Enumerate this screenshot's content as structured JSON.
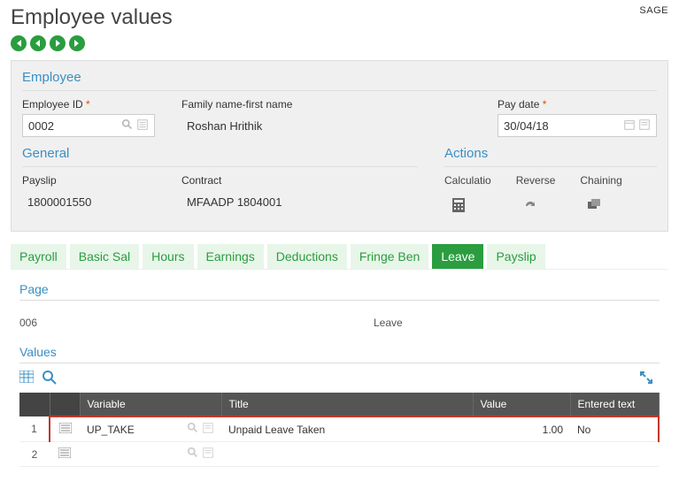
{
  "brand": "SAGE",
  "page_title": "Employee values",
  "employee_section": {
    "title": "Employee",
    "id_label": "Employee ID",
    "id_value": "0002",
    "name_label": "Family name-first name",
    "name_value": "Roshan Hrithik",
    "paydate_label": "Pay date",
    "paydate_value": "30/04/18"
  },
  "general_section": {
    "title": "General",
    "payslip_label": "Payslip",
    "payslip_value": "1800001550",
    "contract_label": "Contract",
    "contract_value": "MFAADP  1804001"
  },
  "actions_section": {
    "title": "Actions",
    "calc": "Calculatio",
    "reverse": "Reverse",
    "chaining": "Chaining"
  },
  "tabs": {
    "payroll": "Payroll",
    "basic": "Basic Sal",
    "hours": "Hours",
    "earnings": "Earnings",
    "deductions": "Deductions",
    "fringe": "Fringe Ben",
    "leave": "Leave",
    "payslip": "Payslip"
  },
  "page_section": {
    "title": "Page",
    "code": "006",
    "name": "Leave"
  },
  "values_section": {
    "title": "Values",
    "col_variable": "Variable",
    "col_title": "Title",
    "col_value": "Value",
    "col_entered": "Entered text",
    "rows": [
      {
        "num": "1",
        "variable": "UP_TAKE",
        "title": "Unpaid Leave Taken",
        "value": "1.00",
        "entered": "No"
      },
      {
        "num": "2",
        "variable": "",
        "title": "",
        "value": "",
        "entered": ""
      }
    ]
  }
}
